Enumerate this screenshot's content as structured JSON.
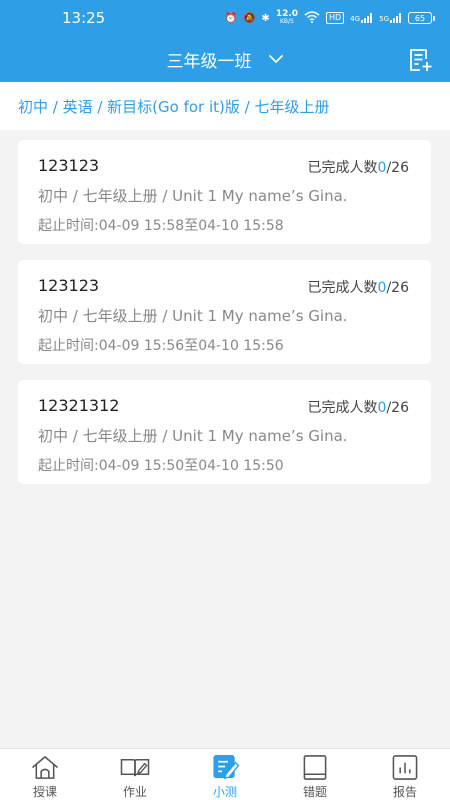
{
  "status_bar": {
    "time": "13:25",
    "net_speed": "12.0",
    "net_unit": "KB/S",
    "hd": "HD",
    "signal1": "4G",
    "signal2": "5G",
    "battery": "65"
  },
  "header": {
    "class_name": "三年级一班"
  },
  "breadcrumb": "初中 / 英语 / 新目标(Go for it)版 / 七年级上册",
  "tests": [
    {
      "name": "123123",
      "progress_label": "已完成人数",
      "completed": "0",
      "total": "/26",
      "path": "初中 / 七年级上册 / Unit 1 My name’s Gina.",
      "time": "起止时间:04-09 15:58至04-10 15:58"
    },
    {
      "name": "123123",
      "progress_label": "已完成人数",
      "completed": "0",
      "total": "/26",
      "path": "初中 / 七年级上册 / Unit 1 My name’s Gina.",
      "time": "起止时间:04-09 15:56至04-10 15:56"
    },
    {
      "name": "12321312",
      "progress_label": "已完成人数",
      "completed": "0",
      "total": "/26",
      "path": "初中 / 七年级上册 / Unit 1 My name’s Gina.",
      "time": "起止时间:04-09 15:50至04-10 15:50"
    }
  ],
  "nav": {
    "items": [
      {
        "label": "授课",
        "icon": "home-icon"
      },
      {
        "label": "作业",
        "icon": "book-icon"
      },
      {
        "label": "小测",
        "icon": "quiz-icon"
      },
      {
        "label": "错题",
        "icon": "notebook-icon"
      },
      {
        "label": "报告",
        "icon": "report-icon"
      }
    ],
    "active_index": 2
  },
  "colors": {
    "accent": "#2e9ee6",
    "background": "#f3f3f3",
    "muted_text": "#888888"
  }
}
